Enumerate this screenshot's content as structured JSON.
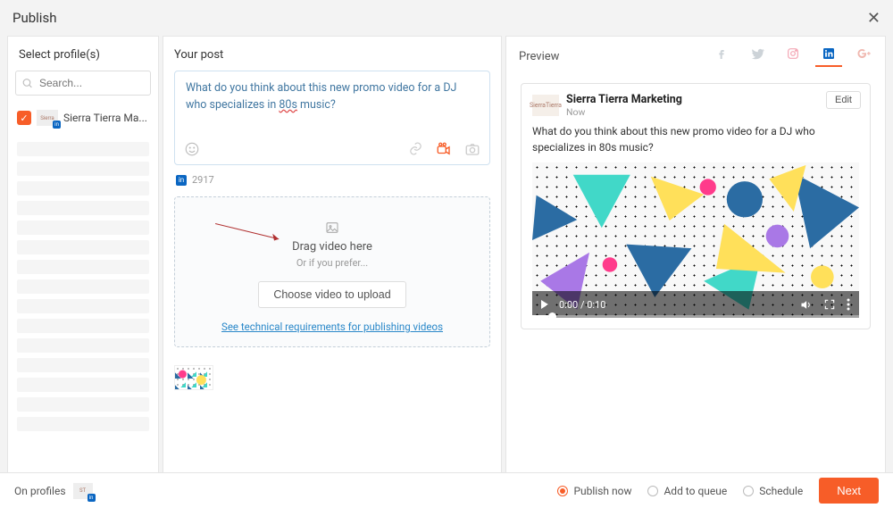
{
  "header": {
    "title": "Publish"
  },
  "profiles": {
    "heading": "Select profile(s)",
    "search_placeholder": "Search...",
    "items": [
      {
        "label": "Sierra Tierra Ma...",
        "checked": true
      }
    ]
  },
  "post": {
    "heading": "Your post",
    "text_pre": "What do you think about this new promo video for a DJ who specializes in ",
    "text_underlined": "80s",
    "text_post": " music?",
    "counter": "2917",
    "drop": {
      "title": "Drag video here",
      "subtitle": "Or if you prefer...",
      "button": "Choose video to upload",
      "tech_link": "See technical requirements for publishing videos"
    }
  },
  "preview": {
    "heading": "Preview",
    "edit": "Edit",
    "author": "Sierra Tierra Marketing",
    "time": "Now",
    "text": "What do you think about this new promo video for a DJ who specializes in 80s music?",
    "video_time": "0:00 / 0:10"
  },
  "footer": {
    "on_profiles": "On profiles",
    "publish_now": "Publish now",
    "add_queue": "Add to queue",
    "schedule": "Schedule",
    "next": "Next"
  }
}
